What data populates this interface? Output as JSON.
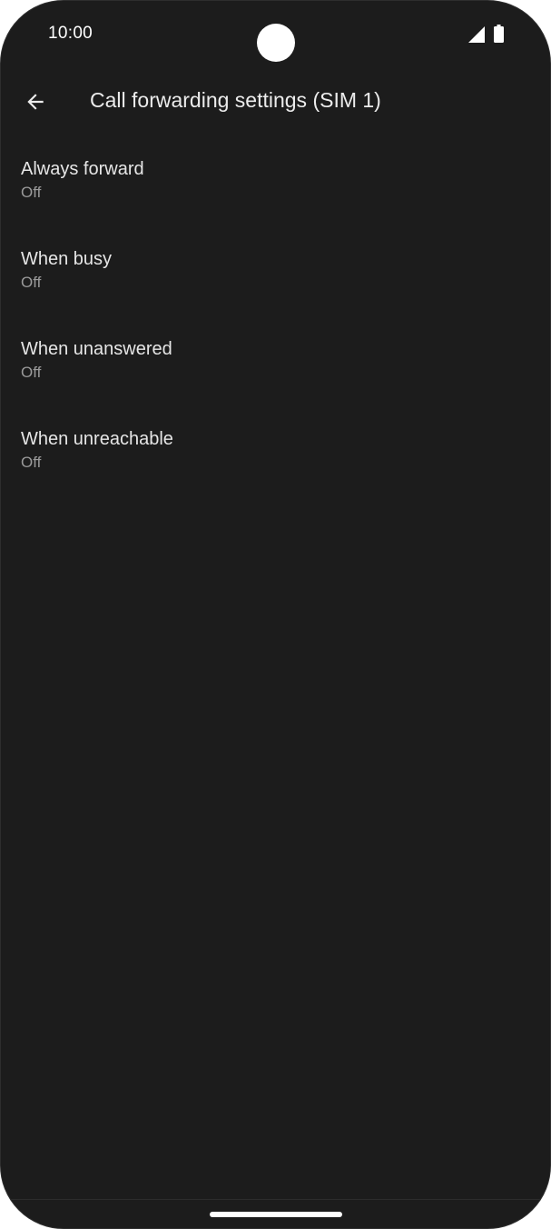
{
  "status_bar": {
    "time": "10:00",
    "icons": [
      "signal-icon",
      "battery-icon"
    ]
  },
  "app_bar": {
    "back_icon": "back-arrow-icon",
    "title": "Call forwarding settings (SIM 1)"
  },
  "settings": [
    {
      "title": "Always forward",
      "summary": "Off"
    },
    {
      "title": "When busy",
      "summary": "Off"
    },
    {
      "title": "When unanswered",
      "summary": "Off"
    },
    {
      "title": "When unreachable",
      "summary": "Off"
    }
  ],
  "colors": {
    "background": "#1c1c1c",
    "title_text": "#ececec",
    "summary_text": "#9a9a9a"
  }
}
